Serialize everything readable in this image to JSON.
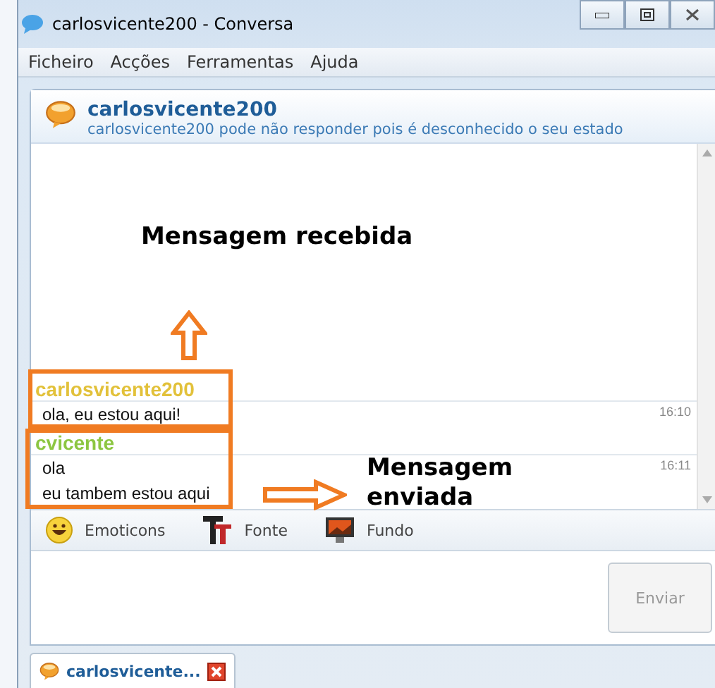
{
  "window": {
    "title": "carlosvicente200 - Conversa"
  },
  "menu": [
    "Ficheiro",
    "Acções",
    "Ferramentas",
    "Ajuda"
  ],
  "contact": {
    "name": "carlosvicente200",
    "status": "carlosvicente200 pode não responder pois é desconhecido o seu estado"
  },
  "messages": [
    {
      "sender": "carlosvicente200",
      "color": "#e2c13a",
      "lines": [
        "ola, eu estou aqui!"
      ],
      "time": "16:10"
    },
    {
      "sender": "cvicente",
      "color": "#8cc641",
      "lines": [
        "ola",
        "eu tambem estou aqui"
      ],
      "time": "16:11"
    }
  ],
  "toolbar": [
    "Emoticons",
    "Fonte",
    "Fundo"
  ],
  "send_button": {
    "label": "Enviar",
    "disabled": true
  },
  "tabs": [
    {
      "label": "carlosvicente...",
      "selected": true
    }
  ],
  "annotations": [
    {
      "kind": "label",
      "text": "Mensagem recebida"
    },
    {
      "kind": "up_arrow"
    },
    {
      "kind": "box"
    },
    {
      "kind": "box"
    },
    {
      "kind": "right_arrow"
    },
    {
      "kind": "label",
      "text": "Mensagem enviada"
    }
  ]
}
